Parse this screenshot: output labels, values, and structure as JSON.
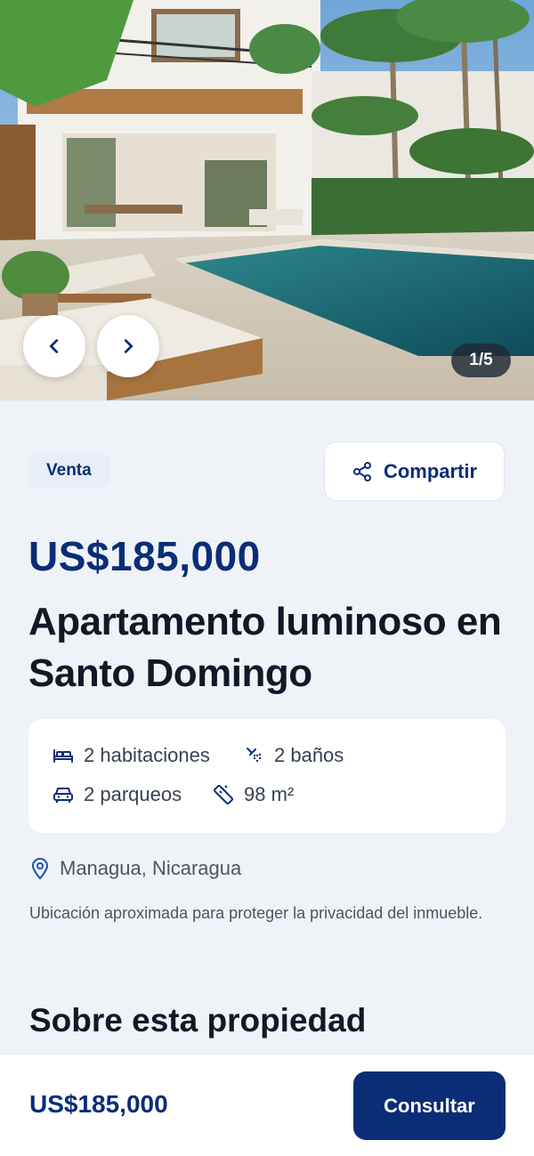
{
  "gallery": {
    "counter": "1/5",
    "icons": {
      "prev": "chevron-left-icon",
      "next": "chevron-right-icon"
    }
  },
  "listing": {
    "badge": "Venta",
    "share_label": "Compartir",
    "price": "US$185,000",
    "title": "Apartamento luminoso en Santo Domingo",
    "features": {
      "bedrooms": "2 habitaciones",
      "bathrooms": "2 baños",
      "parking": "2 parqueos",
      "area": "98 m²"
    },
    "location": "Managua, Nicaragua",
    "location_note": "Ubicación aproximada para proteger la privacidad del inmueble.",
    "about_heading": "Sobre esta propiedad"
  },
  "bottom_bar": {
    "price": "US$185,000",
    "cta_label": "Consultar"
  },
  "colors": {
    "brand": "#0b2d77",
    "background": "#eff3f8",
    "card": "#ffffff",
    "text": "#111827",
    "muted": "#4b5563"
  }
}
